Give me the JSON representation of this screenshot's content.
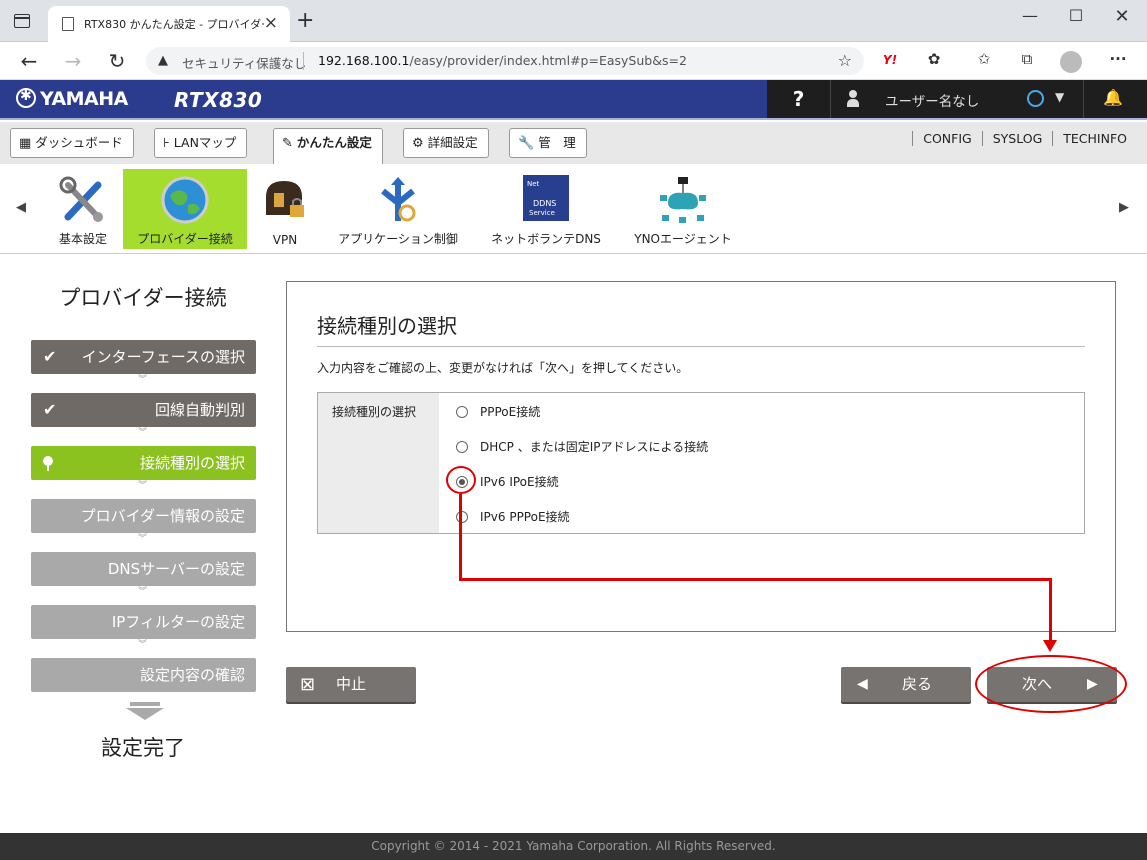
{
  "browser": {
    "tab_title": "RTX830 かんたん設定 - プロバイダー接続",
    "security_label": "セキュリティ保護なし",
    "url_host": "192.168.100.1",
    "url_path": "/easy/provider/index.html#p=EasySub&s=2"
  },
  "header": {
    "brand": "YAMAHA",
    "model": "RTX830",
    "help": "?",
    "user": "ユーザー名なし"
  },
  "main_tabs": [
    {
      "label": "ダッシュボード"
    },
    {
      "label": "LANマップ"
    },
    {
      "label": "かんたん設定"
    },
    {
      "label": "詳細設定"
    },
    {
      "label": "管　理"
    }
  ],
  "top_links": [
    "CONFIG",
    "SYSLOG",
    "TECHINFO"
  ],
  "icon_strip": [
    {
      "label": "基本設定"
    },
    {
      "label": "プロバイダー接続"
    },
    {
      "label": "VPN"
    },
    {
      "label": "アプリケーション制御"
    },
    {
      "label": "ネットボランテDNS",
      "icon_text1": "Net",
      "icon_text2": "DDNS",
      "icon_text3": "Service"
    },
    {
      "label": "YNOエージェント"
    }
  ],
  "sidebar": {
    "title": "プロバイダー接続",
    "steps": [
      {
        "label": "インターフェースの選択",
        "state": "done"
      },
      {
        "label": "回線自動判別",
        "state": "done"
      },
      {
        "label": "接続種別の選択",
        "state": "current"
      },
      {
        "label": "プロバイダー情報の設定",
        "state": "todo"
      },
      {
        "label": "DNSサーバーの設定",
        "state": "todo"
      },
      {
        "label": "IPフィルターの設定",
        "state": "todo"
      },
      {
        "label": "設定内容の確認",
        "state": "todo"
      }
    ],
    "finish": "設定完了"
  },
  "content": {
    "title": "接続種別の選択",
    "description": "入力内容をご確認の上、変更がなければ「次へ」を押してください。",
    "field_label": "接続種別の選択",
    "options": [
      {
        "label": "PPPoE接続",
        "selected": false
      },
      {
        "label": "DHCP 、または固定IPアドレスによる接続",
        "selected": false
      },
      {
        "label": "IPv6 IPoE接続",
        "selected": true
      },
      {
        "label": "IPv6 PPPoE接続",
        "selected": false
      }
    ]
  },
  "buttons": {
    "cancel": "中止",
    "back": "戻る",
    "next": "次へ"
  },
  "footer": "Copyright © 2014 - 2021 Yamaha Corporation. All Rights Reserved.",
  "colors": {
    "header_blue": "#2b3c8e",
    "step_done": "#6f6a66",
    "step_current": "#8cc220",
    "step_todo": "#a9a9a9",
    "annotation_red": "#e00000"
  }
}
